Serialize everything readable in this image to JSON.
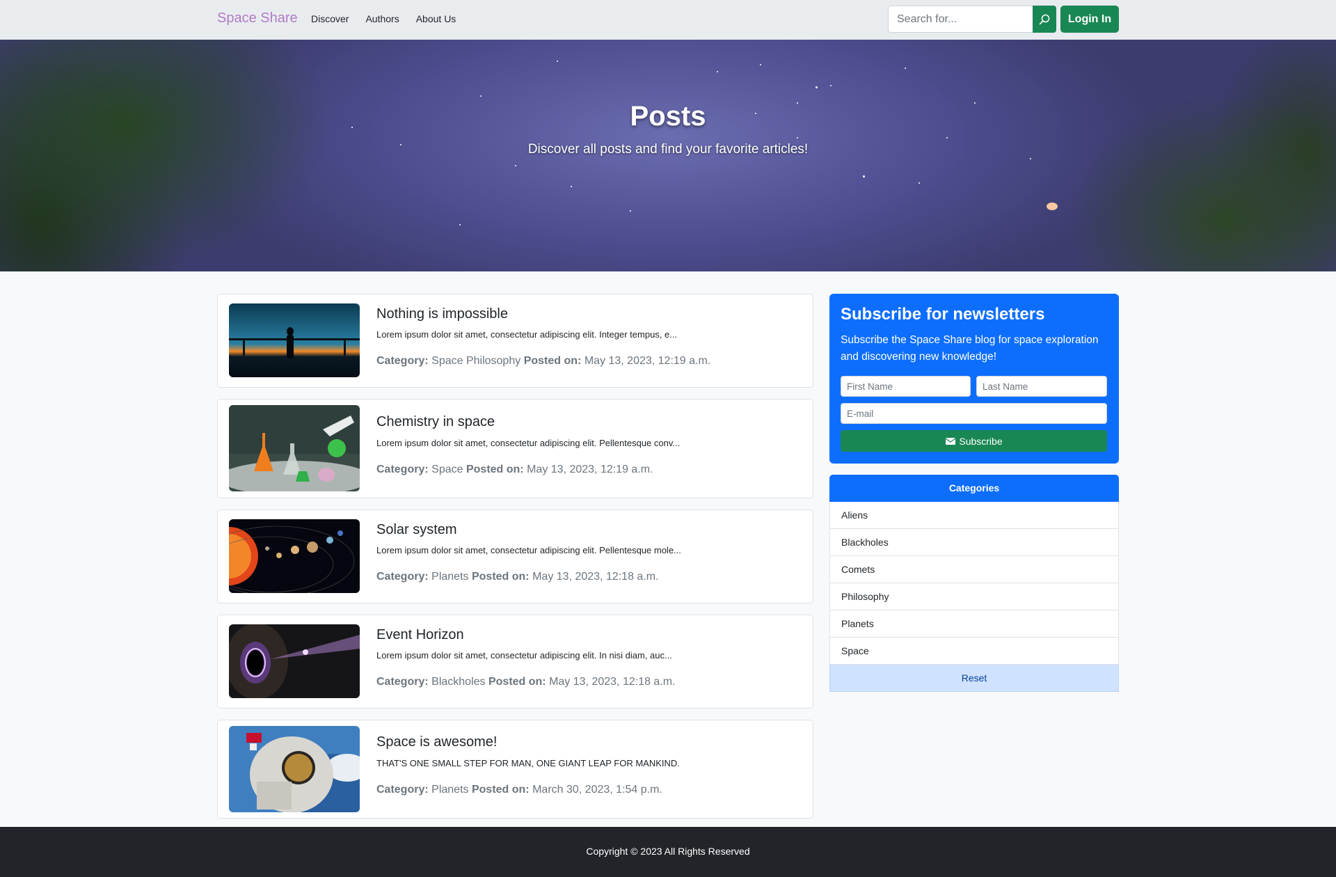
{
  "navbar": {
    "brand": "Space Share",
    "links": [
      "Discover",
      "Authors",
      "About Us"
    ],
    "search_placeholder": "Search for...",
    "login_label": "Login In"
  },
  "hero": {
    "title": "Posts",
    "subtitle": "Discover all posts and find your favorite articles!"
  },
  "posts": [
    {
      "title": "Nothing is impossible",
      "excerpt": "Lorem ipsum dolor sit amet, consectetur adipiscing elit. Integer tempus, e...",
      "category_label": "Category:",
      "category": "Space Philosophy",
      "posted_label": "Posted on:",
      "date": "May 13, 2023, 12:19 a.m.",
      "image": "silhouette-sunset-image"
    },
    {
      "title": "Chemistry in space",
      "excerpt": "Lorem ipsum dolor sit amet, consectetur adipiscing elit. Pellentesque conv...",
      "category_label": "Category:",
      "category": "Space",
      "posted_label": "Posted on:",
      "date": "May 13, 2023, 12:19 a.m.",
      "image": "chemistry-flasks-image"
    },
    {
      "title": "Solar system",
      "excerpt": "Lorem ipsum dolor sit amet, consectetur adipiscing elit. Pellentesque mole...",
      "category_label": "Category:",
      "category": "Planets",
      "posted_label": "Posted on:",
      "date": "May 13, 2023, 12:18 a.m.",
      "image": "solar-system-image"
    },
    {
      "title": "Event Horizon",
      "excerpt": "Lorem ipsum dolor sit amet, consectetur adipiscing elit. In nisi diam, auc...",
      "category_label": "Category:",
      "category": "Blackholes",
      "posted_label": "Posted on:",
      "date": "May 13, 2023, 12:18 a.m.",
      "image": "black-hole-image"
    },
    {
      "title": "Space is awesome!",
      "excerpt": "THAT'S ONE SMALL STEP FOR MAN, ONE GIANT LEAP FOR MANKIND.",
      "category_label": "Category:",
      "category": "Planets",
      "posted_label": "Posted on:",
      "date": "March 30, 2023, 1:54 p.m.",
      "image": "astronaut-image"
    }
  ],
  "newsletter": {
    "title": "Subscribe for newsletters",
    "text": "Subscribe the Space Share blog for space exploration and discovering new knowledge!",
    "first_name_placeholder": "First Name",
    "last_name_placeholder": "Last Name",
    "email_placeholder": "E-mail",
    "button_label": "Subscribe"
  },
  "categories": {
    "header": "Categories",
    "items": [
      "Aliens",
      "Blackholes",
      "Comets",
      "Philosophy",
      "Planets",
      "Space"
    ],
    "reset_label": "Reset"
  },
  "footer": {
    "text": "Copyright © 2023 All Rights Reserved"
  },
  "colors": {
    "primary": "#0d6efd",
    "success": "#198754",
    "brand": "#b07cc6",
    "footer_bg": "#212529"
  }
}
